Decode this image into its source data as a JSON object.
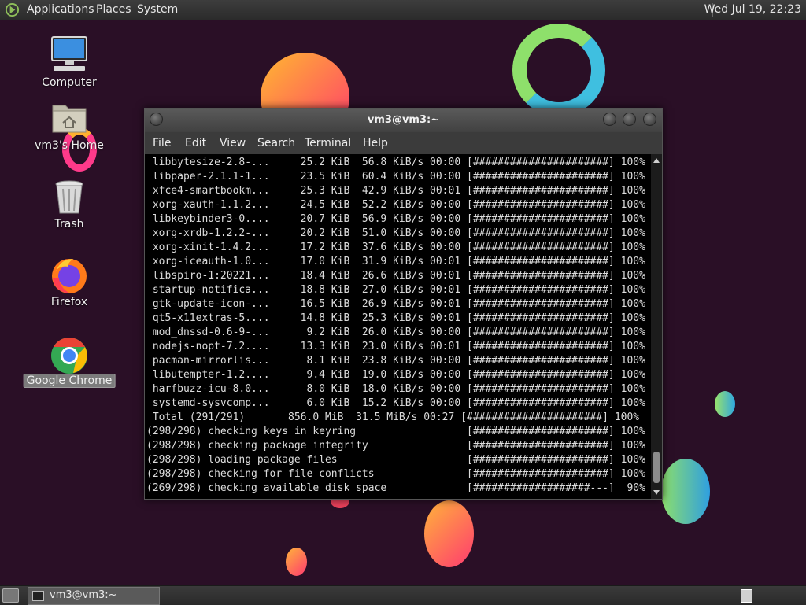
{
  "top_panel": {
    "menus": [
      "Applications",
      "Places",
      "System"
    ],
    "clock": "Wed Jul 19, 22:23"
  },
  "desktop_icons": {
    "computer": "Computer",
    "home": "vm3's Home",
    "trash": "Trash",
    "firefox": "Firefox",
    "chrome": "Google Chrome"
  },
  "window": {
    "title": "vm3@vm3:~",
    "menus": [
      "File",
      "Edit",
      "View",
      "Search",
      "Terminal",
      "Help"
    ]
  },
  "terminal_lines": [
    " libbytesize-2.8-...     25.2 KiB  56.8 KiB/s 00:00 [######################] 100%",
    " libpaper-2.1.1-1...     23.5 KiB  60.4 KiB/s 00:00 [######################] 100%",
    " xfce4-smartbookm...     25.3 KiB  42.9 KiB/s 00:01 [######################] 100%",
    " xorg-xauth-1.1.2...     24.5 KiB  52.2 KiB/s 00:00 [######################] 100%",
    " libkeybinder3-0....     20.7 KiB  56.9 KiB/s 00:00 [######################] 100%",
    " xorg-xrdb-1.2.2-...     20.2 KiB  51.0 KiB/s 00:00 [######################] 100%",
    " xorg-xinit-1.4.2...     17.2 KiB  37.6 KiB/s 00:00 [######################] 100%",
    " xorg-iceauth-1.0...     17.0 KiB  31.9 KiB/s 00:01 [######################] 100%",
    " libspiro-1:20221...     18.4 KiB  26.6 KiB/s 00:01 [######################] 100%",
    " startup-notifica...     18.8 KiB  27.0 KiB/s 00:01 [######################] 100%",
    " gtk-update-icon-...     16.5 KiB  26.9 KiB/s 00:01 [######################] 100%",
    " qt5-x11extras-5....     14.8 KiB  25.3 KiB/s 00:01 [######################] 100%",
    " mod_dnssd-0.6-9-...      9.2 KiB  26.0 KiB/s 00:00 [######################] 100%",
    " nodejs-nopt-7.2....     13.3 KiB  23.0 KiB/s 00:01 [######################] 100%",
    " pacman-mirrorlis...      8.1 KiB  23.8 KiB/s 00:00 [######################] 100%",
    " libutempter-1.2....      9.4 KiB  19.0 KiB/s 00:00 [######################] 100%",
    " harfbuzz-icu-8.0...      8.0 KiB  18.0 KiB/s 00:00 [######################] 100%",
    " systemd-sysvcomp...      6.0 KiB  15.2 KiB/s 00:00 [######################] 100%",
    " Total (291/291)       856.0 MiB  31.5 MiB/s 00:27 [######################] 100%",
    "(298/298) checking keys in keyring                  [######################] 100%",
    "(298/298) checking package integrity                [######################] 100%",
    "(298/298) loading package files                     [######################] 100%",
    "(298/298) checking for file conflicts               [######################] 100%",
    "(269/298) checking available disk space             [###################---]  90%"
  ],
  "taskbar": {
    "task_label": "vm3@vm3:~"
  }
}
